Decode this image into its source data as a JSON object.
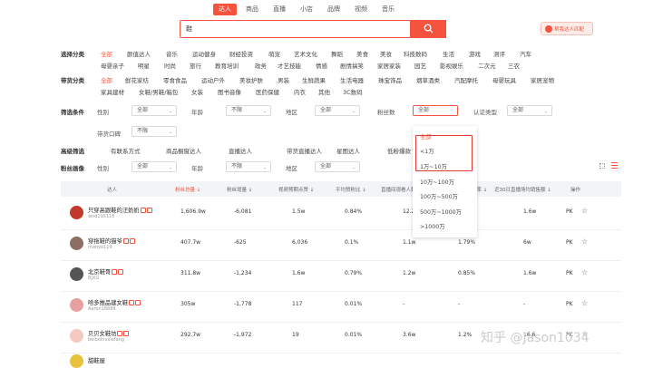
{
  "tabs": [
    "达人",
    "商品",
    "直播",
    "小店",
    "品牌",
    "视频",
    "音乐"
  ],
  "search": {
    "value": "鞋"
  },
  "help_button": "帮我达人匹配",
  "select_category": {
    "label": "选择分类",
    "row1": [
      "全部",
      "颜值达人",
      "音乐",
      "运动健身",
      "财经投资",
      "萌宠",
      "艺术文化",
      "舞蹈",
      "美食",
      "美妆",
      "科技数码",
      "生活",
      "游戏",
      "测评",
      "汽车"
    ],
    "row2": [
      "母婴亲子",
      "明星",
      "时尚",
      "旅行",
      "教育培训",
      "政务",
      "才艺技能",
      "情感",
      "剧情搞笑",
      "家居家装",
      "园艺",
      "影视娱乐",
      "二次元",
      "三农"
    ]
  },
  "goods_category": {
    "label": "带货分类",
    "row1": [
      "全部",
      "鲜花家纺",
      "零食食品",
      "运动户外",
      "美妆护肤",
      "男装",
      "生鲜蔬果",
      "生活电器",
      "珠宝饰品",
      "烟草酒类",
      "汽配摩托",
      "母婴玩具",
      "家居宠物"
    ],
    "row2": [
      "家具建材",
      "女鞋/男鞋/箱包",
      "女装",
      "图书音像",
      "医药保健",
      "内衣",
      "其他",
      "3C数码"
    ]
  },
  "filters": {
    "label": "筛选条件",
    "gender": "性别",
    "gender_val": "全部",
    "age": "年龄",
    "age_val": "不限",
    "region": "地区",
    "region_val": "全部",
    "fans": "粉丝数",
    "fans_val": "全部",
    "auth": "认证类型",
    "auth_val": "全部",
    "shop": "带货口碑",
    "shop_val": "不限"
  },
  "advanced": {
    "label": "高级筛选",
    "items": [
      "有联系方式",
      "商品橱窗达人",
      "直播达人",
      "带货直播达人",
      "星图达人",
      "低粉爆款"
    ]
  },
  "fan_portrait": {
    "label": "粉丝画像",
    "gender": "性别",
    "gender_val": "全部",
    "age": "年龄",
    "age_val": "不限",
    "region": "地区",
    "region_val": "全部"
  },
  "fans_dropdown": [
    "全部",
    "<1万",
    "1万~10万",
    "10万~100万",
    "100万~500万",
    "500万~1000万",
    ">1000万"
  ],
  "table": {
    "headers": [
      "达人",
      "粉丝总量 ↓",
      "粉丝增量 ↓",
      "视频预期点赞 ↓",
      "平均赞粉比 ↓",
      "直播间观看人数 ↓",
      "直播间转化率 ↓",
      "近30日直播场均销售额 ↓",
      "操作"
    ],
    "rows": [
      {
        "name": "只穿高跟鞋的汪奶奶",
        "id": "wnd115115",
        "fans": "1,606.9w",
        "inc": "-6,081",
        "likes": "1.5w",
        "ratio": "0.84%",
        "views": "12.2",
        "conv": "",
        "sales": "1.6w",
        "op": "PK"
      },
      {
        "name": "穿拖鞋的猫爷",
        "id": "maoye119",
        "fans": "407.7w",
        "inc": "-625",
        "likes": "6,036",
        "ratio": "0.1%",
        "views": "1.1w",
        "conv": "1.79%",
        "sales": "6w",
        "op": "PK"
      },
      {
        "name": "北京鞋哥",
        "id": "BJXG",
        "fans": "311.8w",
        "inc": "-1,234",
        "likes": "1.6w",
        "ratio": "0.79%",
        "views": "1.2w",
        "conv": "0.85%",
        "sales": "1.6w",
        "op": "PK"
      },
      {
        "name": "哈多推品建女鞋",
        "id": "Aaron16888",
        "fans": "305w",
        "inc": "-1,778",
        "likes": "117",
        "ratio": "0.01%",
        "views": "-",
        "conv": "-",
        "sales": "-",
        "op": "PK"
      },
      {
        "name": "贝贝女鞋坊",
        "id": "beibeinvxiefang",
        "fans": "292.7w",
        "inc": "-1,972",
        "likes": "19",
        "ratio": "0.01%",
        "views": "3.6w",
        "conv": "1.2%",
        "sales": "16.6",
        "op": "PK"
      }
    ],
    "row6_name": "甜鞋屋"
  },
  "watermark": "知乎 @Jason1034",
  "colors": {
    "accent": "#f5533d"
  }
}
